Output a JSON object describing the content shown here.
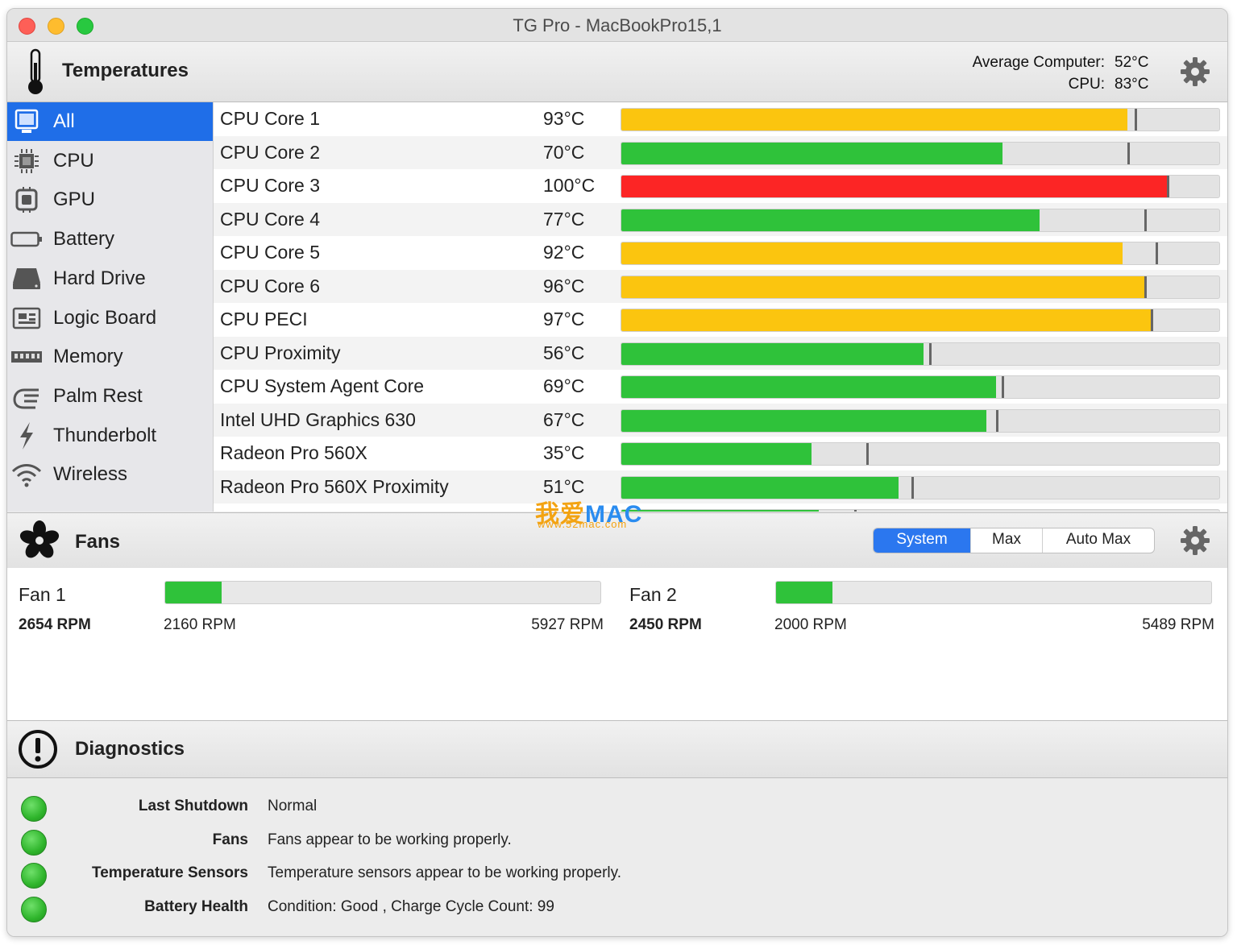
{
  "window": {
    "title": "TG Pro - MacBookPro15,1"
  },
  "temperatures": {
    "title": "Temperatures",
    "average_label": "Average Computer:",
    "average_value": "52°C",
    "cpu_label": "CPU:",
    "cpu_value": "83°C"
  },
  "sidebar": {
    "items": [
      {
        "label": "All",
        "icon": "computer-icon",
        "selected": true
      },
      {
        "label": "CPU",
        "icon": "cpu-chip-icon"
      },
      {
        "label": "GPU",
        "icon": "gpu-chip-icon"
      },
      {
        "label": "Battery",
        "icon": "battery-icon"
      },
      {
        "label": "Hard Drive",
        "icon": "hard-drive-icon"
      },
      {
        "label": "Logic Board",
        "icon": "logic-board-icon"
      },
      {
        "label": "Memory",
        "icon": "memory-icon"
      },
      {
        "label": "Palm Rest",
        "icon": "palm-rest-icon"
      },
      {
        "label": "Thunderbolt",
        "icon": "thunderbolt-icon"
      },
      {
        "label": "Wireless",
        "icon": "wireless-icon"
      }
    ]
  },
  "sensors": [
    {
      "name": "CPU Core 1",
      "value": "93°C",
      "level": 0.847,
      "max": 0.858,
      "color": "#fbc50f"
    },
    {
      "name": "CPU Core 2",
      "value": "70°C",
      "level": 0.637,
      "max": 0.847,
      "color": "#2fc23a"
    },
    {
      "name": "CPU Core 3",
      "value": "100°C",
      "level": 0.913,
      "max": 0.913,
      "color": "#fc2525"
    },
    {
      "name": "CPU Core 4",
      "value": "77°C",
      "level": 0.699,
      "max": 0.875,
      "color": "#2fc23a"
    },
    {
      "name": "CPU Core 5",
      "value": "92°C",
      "level": 0.838,
      "max": 0.894,
      "color": "#fbc50f"
    },
    {
      "name": "CPU Core 6",
      "value": "96°C",
      "level": 0.875,
      "max": 0.875,
      "color": "#fbc50f"
    },
    {
      "name": "CPU PECI",
      "value": "97°C",
      "level": 0.885,
      "max": 0.885,
      "color": "#fbc50f"
    },
    {
      "name": "CPU Proximity",
      "value": "56°C",
      "level": 0.506,
      "max": 0.515,
      "color": "#2fc23a"
    },
    {
      "name": "CPU System Agent Core",
      "value": "69°C",
      "level": 0.627,
      "max": 0.636,
      "color": "#2fc23a"
    },
    {
      "name": "Intel UHD Graphics 630",
      "value": "67°C",
      "level": 0.61,
      "max": 0.627,
      "color": "#2fc23a"
    },
    {
      "name": "Radeon Pro 560X",
      "value": "35°C",
      "level": 0.318,
      "max": 0.41,
      "color": "#2fc23a"
    },
    {
      "name": "Radeon Pro 560X Proximity",
      "value": "51°C",
      "level": 0.464,
      "max": 0.485,
      "color": "#2fc23a"
    },
    {
      "name": "",
      "value": "",
      "level": 0.33,
      "max": 0.39,
      "color": "#2fc23a"
    }
  ],
  "fans": {
    "title": "Fans",
    "modes": [
      "System",
      "Max",
      "Auto Max"
    ],
    "active_mode": "System",
    "items": [
      {
        "name": "Fan 1",
        "rpm": "2654 RPM",
        "min": "2160 RPM",
        "max": "5927 RPM",
        "level": 0.13
      },
      {
        "name": "Fan 2",
        "rpm": "2450 RPM",
        "min": "2000 RPM",
        "max": "5489 RPM",
        "level": 0.13
      }
    ]
  },
  "diagnostics": {
    "title": "Diagnostics",
    "rows": [
      {
        "label": "Last Shutdown",
        "value": "Normal",
        "status_color": "#2fb52c"
      },
      {
        "label": "Fans",
        "value": "Fans appear to be working properly.",
        "status_color": "#2fb52c"
      },
      {
        "label": "Temperature Sensors",
        "value": "Temperature sensors appear to be working properly.",
        "status_color": "#2fb52c"
      },
      {
        "label": "Battery Health",
        "value": "Condition: Good , Charge Cycle Count: 99",
        "status_color": "#2fb52c"
      }
    ]
  },
  "watermark": {
    "text_cn": "我爱",
    "text_en": "MAC",
    "url": "www.52mac.com"
  }
}
